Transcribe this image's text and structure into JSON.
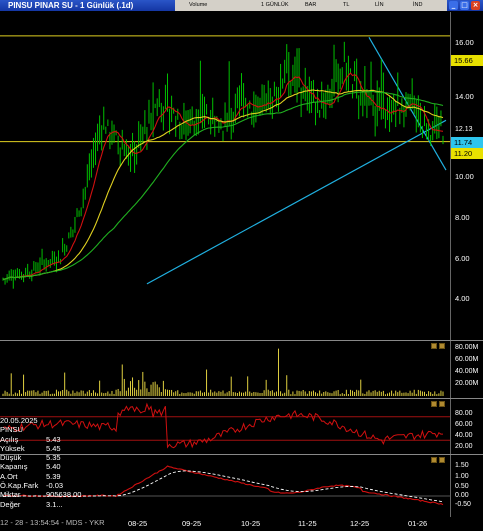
{
  "window": {
    "title": "PINSU PINAR SU - 1 Günlük (.1d)",
    "toolbar": {
      "period_label": "1 GÜNLÜK",
      "bar_label": "BAR",
      "tl_label": "TL",
      "lin_label": "LİN",
      "ind_label": "İND",
      "volume_label": "Volume"
    }
  },
  "price_axis": {
    "labels": [
      "16.00",
      "15.66",
      "14.00",
      "12.13",
      "11.74",
      "11.20",
      "10.00",
      "8.00",
      "6.00",
      "4.00"
    ],
    "badges": {
      "high": "15.66",
      "mid": "12.13",
      "last": "11.74",
      "support": "11.20"
    }
  },
  "volume_axis": {
    "labels": [
      "80.00M",
      "60.00M",
      "40.00M",
      "20.00M"
    ]
  },
  "osc1_axis": {
    "labels": [
      "80.00",
      "60.00",
      "40.00",
      "20.00"
    ]
  },
  "osc2_axis": {
    "labels": [
      "1.50",
      "1.00",
      "0.50",
      "0.00",
      "-0.50"
    ]
  },
  "x_axis": {
    "labels": [
      "08-25",
      "09-25",
      "10-25",
      "11-25",
      "12-25",
      "01-26"
    ]
  },
  "info_panel": {
    "date": "20.05.2025",
    "symbol": "PINSU",
    "rows": [
      {
        "key": "Açılış",
        "value": "5.43"
      },
      {
        "key": "Yüksek",
        "value": "5.45"
      },
      {
        "key": "Düşük",
        "value": "5.35"
      },
      {
        "key": "Kapanış",
        "value": "5.40"
      },
      {
        "key": "A.Ort",
        "value": "5.39"
      },
      {
        "key": "Ö.Kap.Fark",
        "value": "-0.03"
      },
      {
        "key": "Miktar",
        "value": "905638.00"
      },
      {
        "key": "Değer",
        "value": "3.1..."
      }
    ]
  },
  "status_text": "12 - 28 - 13:54:54 - MDS - YKR",
  "colors": {
    "candle": "#00c000",
    "ma_fast": "#d01010",
    "ma_mid": "#e0d020",
    "ma_slow": "#20b020",
    "trend": "#20b0e0",
    "hline": "#e0d020",
    "volume": "#e0d040",
    "osc_line": "#d01010"
  },
  "chart_data": {
    "type": "line",
    "title": "PINSU PINAR SU - 1 Günlük (.1d)",
    "x_tick_labels": [
      "08-25",
      "09-25",
      "10-25",
      "11-25",
      "12-25",
      "01-26"
    ],
    "price_ylim": [
      3.0,
      16.5
    ],
    "horizontal_levels": [
      15.66,
      11.2
    ],
    "last_price": 11.74,
    "close_approx": [
      5.4,
      5.6,
      5.7,
      6.1,
      6.3,
      7.6,
      9.6,
      12.0,
      11.2,
      10.6,
      11.6,
      13.0,
      12.3,
      11.8,
      12.6,
      11.8,
      12.2,
      13.0,
      12.6,
      12.7,
      14.4,
      13.4,
      12.8,
      12.9,
      14.6,
      13.0,
      12.6,
      12.3,
      12.8,
      12.7,
      11.6,
      11.74
    ]
  }
}
